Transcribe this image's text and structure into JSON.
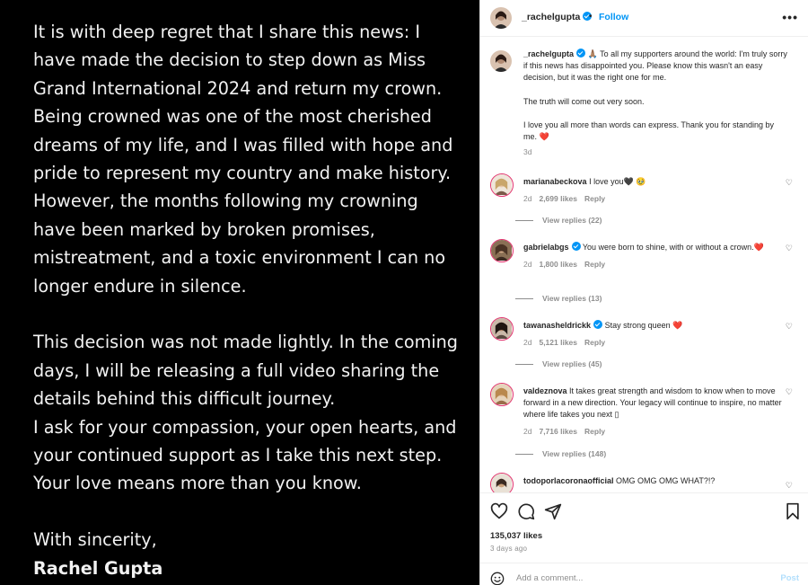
{
  "media": {
    "paragraphs": [
      "It is with deep regret that I share this news: I have made the decision to step down as Miss Grand International 2024 and return my crown.",
      "Being crowned was one of the most cherished dreams of my life, and I was filled with hope and pride to represent my country and make history.",
      "However, the months following my crowning have been marked by broken promises, mistreatment, and a toxic environment I can no longer endure in silence.",
      "This decision was not made lightly. In the coming days, I will be releasing a full video sharing the details behind this difficult journey.",
      "I ask for your compassion, your open hearts, and your continued support as I take this next step. Your love means more than you know.",
      "With sincerity,",
      "Rachel Gupta"
    ]
  },
  "header": {
    "username": "_rachelgupta",
    "separator": "•",
    "follow_label": "Follow",
    "more_label": "•••"
  },
  "caption": {
    "username": "_rachelgupta",
    "line1": "🙏🏽 To all my supporters around the world: I'm truly sorry if this news has disappointed you. Please know this wasn't an easy decision, but it was the right one for me.",
    "line2": "The truth will come out very soon.",
    "line3": "I love you all more than words can express. Thank you for standing by me. ❤️",
    "time": "3d"
  },
  "comments": [
    {
      "username": "marianabeckova",
      "text": "I love you🖤 🥹",
      "time": "2d",
      "likes": "2,699 likes",
      "reply": "Reply",
      "view_replies": "View replies (22)"
    },
    {
      "username": "gabrielabgs",
      "text": "You were born to shine, with or without a crown.❤️",
      "time": "2d",
      "likes": "1,800 likes",
      "reply": "Reply",
      "view_replies": "View replies (13)"
    },
    {
      "username": "tawanasheldrickk",
      "text": "Stay strong queen ❤️",
      "time": "2d",
      "likes": "5,121 likes",
      "reply": "Reply",
      "view_replies": "View replies (45)"
    },
    {
      "username": "valdeznova",
      "text": "It takes great strength and wisdom to know when to move forward in a new direction. Your legacy will continue to inspire, no matter where life takes you next ▯",
      "time": "2d",
      "likes": "7,716 likes",
      "reply": "Reply",
      "view_replies": "View replies (148)"
    },
    {
      "username": "todoporlacoronaofficial",
      "text": "OMG OMG OMG WHAT?!?"
    }
  ],
  "actions": {
    "likes": "135,037 likes",
    "ago": "3 days ago"
  },
  "add_comment": {
    "placeholder": "Add a comment...",
    "post_label": "Post"
  },
  "colors": {
    "accent": "#0095f6",
    "heart": "#ed4956",
    "story_ring": "#e1306c"
  }
}
